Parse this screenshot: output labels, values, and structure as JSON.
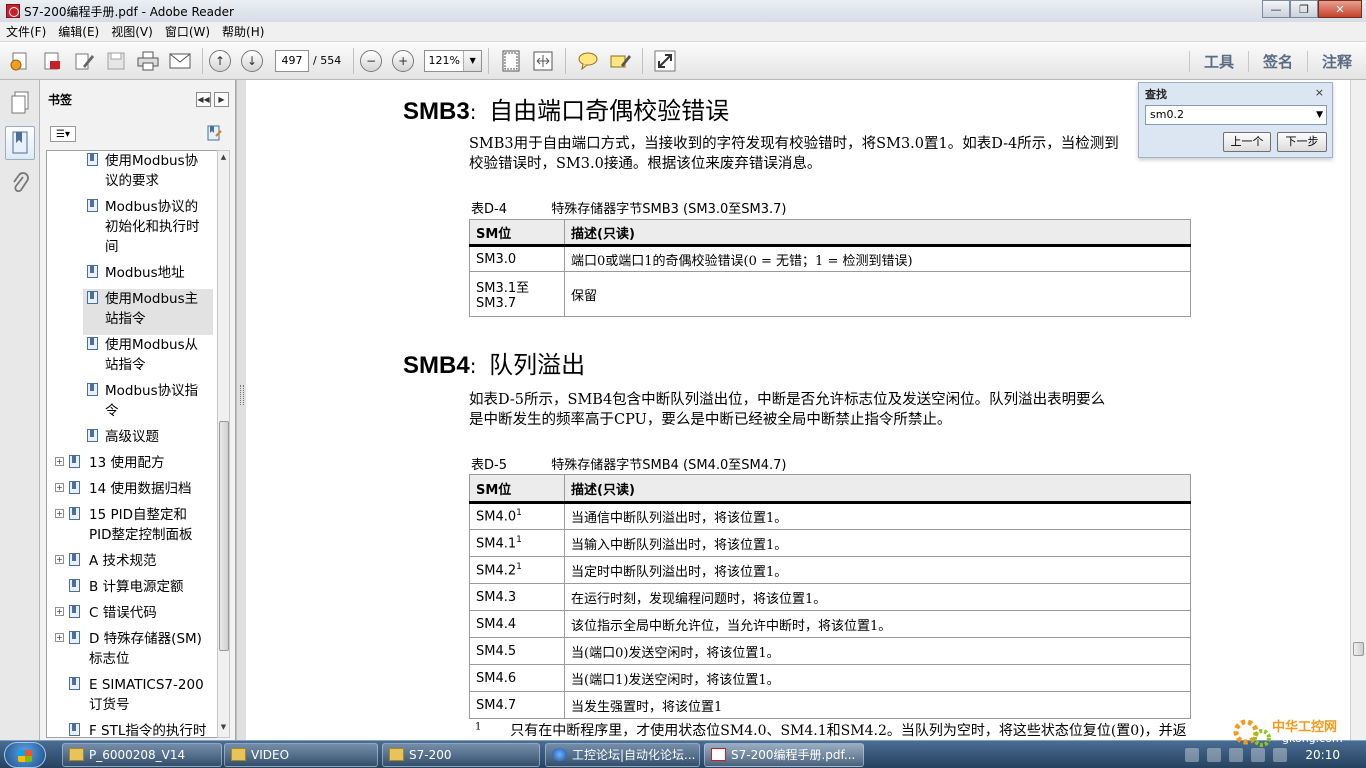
{
  "window": {
    "title": "S7-200编程手册.pdf - Adobe Reader"
  },
  "menu": [
    "文件(F)",
    "编辑(E)",
    "视图(V)",
    "窗口(W)",
    "帮助(H)"
  ],
  "toolbar": {
    "page_current": "497",
    "page_total": "/ 554",
    "zoom": "121%",
    "right_tabs": [
      "工具",
      "签名",
      "注释"
    ]
  },
  "bookmarks": {
    "header": "书签",
    "items": [
      {
        "text": "使用Modbus协议的要求",
        "lines": [
          "使用Modbus协",
          "议的要求"
        ],
        "level": 2
      },
      {
        "text": "Modbus协议的初始化和执行时间",
        "lines": [
          "Modbus协议的",
          "初始化和执行时",
          "间"
        ],
        "level": 2
      },
      {
        "text": "Modbus地址",
        "lines": [
          "Modbus地址"
        ],
        "level": 2
      },
      {
        "text": "使用Modbus主站指令",
        "lines": [
          "使用Modbus主",
          "站指令"
        ],
        "level": 2,
        "selected": true
      },
      {
        "text": "使用Modbus从站指令",
        "lines": [
          "使用Modbus从",
          "站指令"
        ],
        "level": 2
      },
      {
        "text": "Modbus协议指令",
        "lines": [
          "Modbus协议指",
          "令"
        ],
        "level": 2
      },
      {
        "text": "高级议题",
        "lines": [
          "高级议题"
        ],
        "level": 2
      },
      {
        "text": "13 使用配方",
        "lines": [
          "13 使用配方"
        ],
        "level": 1,
        "expandable": true
      },
      {
        "text": "14 使用数据归档",
        "lines": [
          "14 使用数据归档"
        ],
        "level": 1,
        "expandable": true
      },
      {
        "text": "15 PID自整定和PID整定控制面板",
        "lines": [
          "15 PID自整定和",
          "PID整定控制面板"
        ],
        "level": 1,
        "expandable": true
      },
      {
        "text": "A 技术规范",
        "lines": [
          "A 技术规范"
        ],
        "level": 1,
        "expandable": true
      },
      {
        "text": "B 计算电源定额",
        "lines": [
          "B 计算电源定额"
        ],
        "level": 1,
        "expandable": false
      },
      {
        "text": "C 错误代码",
        "lines": [
          "C 错误代码"
        ],
        "level": 1,
        "expandable": true
      },
      {
        "text": "D 特殊存储器(SM)标志位",
        "lines": [
          "D 特殊存储器(SM)",
          "标志位"
        ],
        "level": 1,
        "expandable": true
      },
      {
        "text": "E SIMATICS7-200订货号",
        "lines": [
          "E SIMATICS7-200",
          "订货号"
        ],
        "level": 1,
        "expandable": false
      },
      {
        "text": "F STL指令的执行时间",
        "lines": [
          "F STL指令的执行时"
        ],
        "level": 1,
        "expandable": false
      }
    ]
  },
  "document": {
    "smb3": {
      "code": "SMB3",
      "title": "自由端口奇偶校验错误",
      "para_line1": "SMB3用于自由端口方式，当接收到的字符发现有校验错时，将SM3.0置1。如表D-4所示，当检测到",
      "para_line2": "校验错误时，SM3.0接通。根据该位来废弃错误消息。",
      "table_label": "表D-4",
      "table_caption": "特殊存储器字节SMB3 (SM3.0至SM3.7)",
      "headers": [
        "SM位",
        "描述(只读)"
      ],
      "rows": [
        {
          "bit": "SM3.0",
          "desc": "端口0或端口1的奇偶校验错误(0 = 无错；1 = 检测到错误)"
        },
        {
          "bit_line1": "SM3.1至",
          "bit_line2": "SM3.7",
          "desc": "保留"
        }
      ]
    },
    "smb4": {
      "code": "SMB4",
      "title": "队列溢出",
      "para_line1": "如表D-5所示，SMB4包含中断队列溢出位，中断是否允许标志位及发送空闲位。队列溢出表明要么",
      "para_line2": "是中断发生的频率高于CPU，要么是中断已经被全局中断禁止指令所禁止。",
      "table_label": "表D-5",
      "table_caption": "特殊存储器字节SMB4 (SM4.0至SM4.7)",
      "headers": [
        "SM位",
        "描述(只读)"
      ],
      "rows": [
        {
          "bit": "SM4.0",
          "sup": "1",
          "desc": "当通信中断队列溢出时，将该位置1。"
        },
        {
          "bit": "SM4.1",
          "sup": "1",
          "desc": "当输入中断队列溢出时，将该位置1。"
        },
        {
          "bit": "SM4.2",
          "sup": "1",
          "desc": "当定时中断队列溢出时，将该位置1。"
        },
        {
          "bit": "SM4.3",
          "sup": "",
          "desc": "在运行时刻，发现编程问题时，将该位置1。"
        },
        {
          "bit": "SM4.4",
          "sup": "",
          "desc": "该位指示全局中断允许位，当允许中断时，将该位置1。"
        },
        {
          "bit": "SM4.5",
          "sup": "",
          "desc": "当(端口0)发送空闲时，将该位置1。"
        },
        {
          "bit": "SM4.6",
          "sup": "",
          "desc": "当(端口1)发送空闲时，将该位置1。"
        },
        {
          "bit": "SM4.7",
          "sup": "",
          "desc": "当发生强置时，将该位置1"
        }
      ],
      "footnote_mark": "1",
      "footnote": "只有在中断程序里，才使用状态位SM4.0、SM4.1和SM4.2。当队列为空时，将这些状态位复位(置0)，并返"
    }
  },
  "find": {
    "title": "查找",
    "close": "×",
    "query": "sm0.2",
    "prev": "上一个",
    "next": "下一步"
  },
  "taskbar": {
    "items": [
      "P_6000208_V14",
      "VIDEO",
      "S7-200",
      "工控论坛|自动化论坛...",
      "S7-200编程手册.pdf..."
    ],
    "clock": "20:10"
  },
  "watermark": {
    "line1": "中华工控网",
    "line2": "gkong.com"
  },
  "colors": {
    "toolbar_tab": "#5a6b82",
    "taskbar": "#26425f",
    "find_panel": "#dbe6f2",
    "watermark_orange": "#f39a1c"
  }
}
